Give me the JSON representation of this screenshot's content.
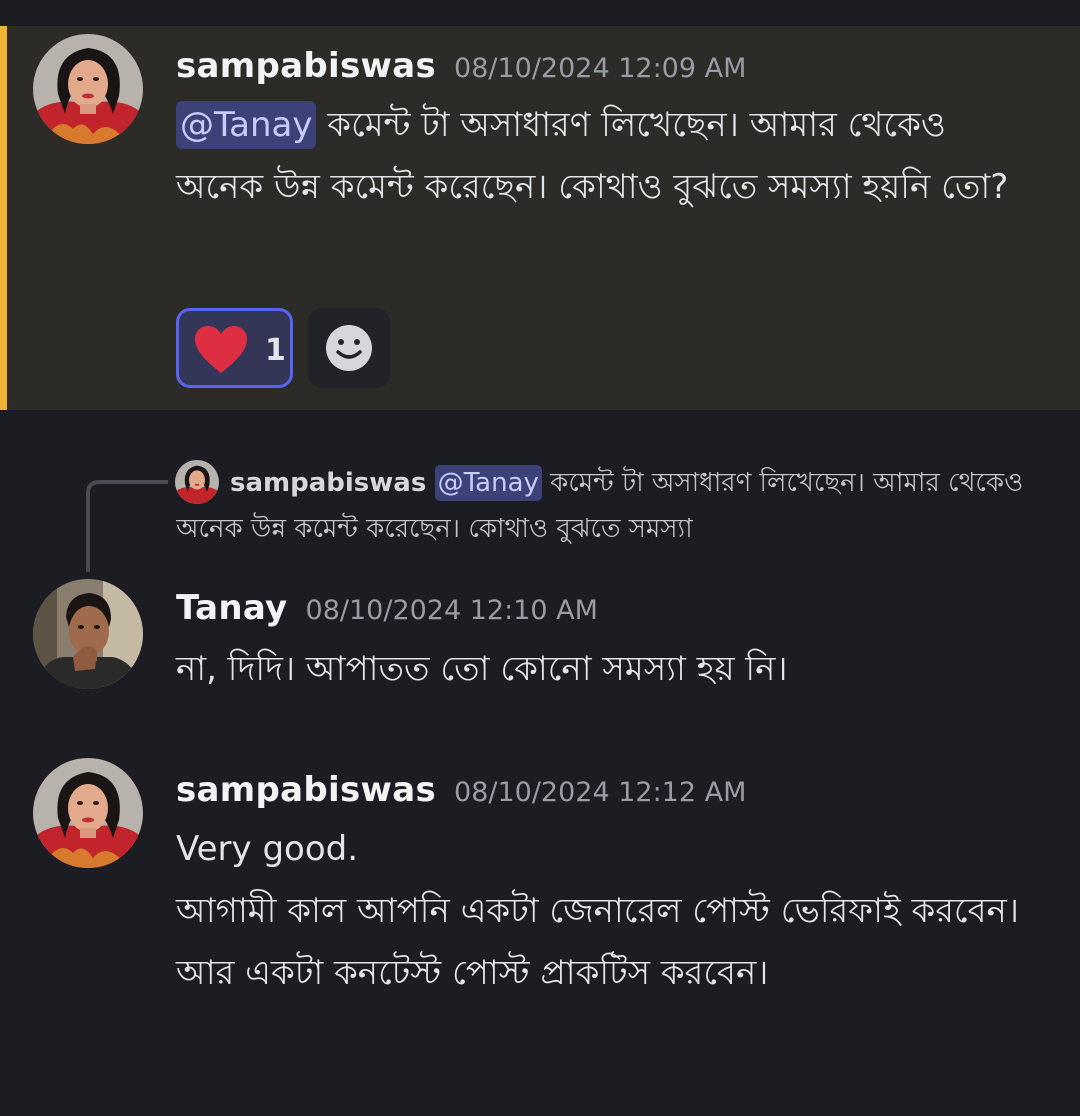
{
  "messages": [
    {
      "username": "sampabiswas",
      "timestamp": "08/10/2024 12:09 AM",
      "mention": "@Tanay",
      "text": " কমেন্ট টা অসাধারণ লিখেছেন। আমার থেকেও অনেক উন্ন কমেন্ট করেছেন। কোথাও বুঝতে সমস্যা হয়নি তো?",
      "reaction": {
        "emoji": "heart-icon",
        "count": "1"
      },
      "highlight_color": "#f0b232"
    },
    {
      "reply": {
        "username": "sampabiswas",
        "mention": "@Tanay",
        "text": " কমেন্ট টা অসাধারণ লিখেছেন। আমার থেকেও অনেক উন্ন কমেন্ট করেছেন। কোথাও বুঝতে সমস্যা"
      },
      "username": "Tanay",
      "timestamp": "08/10/2024 12:10 AM",
      "text": "না, দিদি। আপাতত তো কোনো সমস্যা হয় নি।"
    },
    {
      "username": "sampabiswas",
      "timestamp": "08/10/2024 12:12 AM",
      "line1": "Very good.",
      "line2": "আগামী কাল আপনি একটা জেনারেল পোস্ট ভেরিফাই করবেন। আর একটা কনটেস্ট পোস্ট প্রাকটিস করবেন।"
    }
  ],
  "colors": {
    "background": "#1c1d22",
    "highlight_background": "#2c2b27",
    "mention_background": "#3c4178",
    "reaction_border": "#5865f2"
  }
}
